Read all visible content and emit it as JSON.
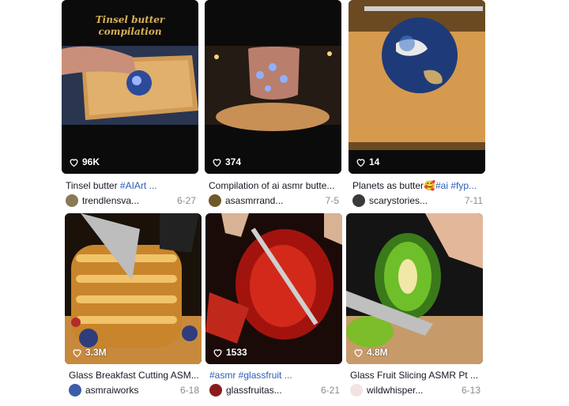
{
  "cards": [
    {
      "likes": "96K",
      "caption_text": "Tinsel butter ",
      "caption_tag": "#AIArt ...",
      "author": "trendlensva...",
      "date": "6-27",
      "overlay_title_1": "Tinsel butter",
      "overlay_title_2": "compilation",
      "avatar_color": "#8a7a55"
    },
    {
      "likes": "374",
      "caption_text": "Compilation of ai asmr butte...",
      "caption_tag": "",
      "author": "asasmrrand...",
      "date": "7-5",
      "avatar_color": "#6e5a2b"
    },
    {
      "likes": "14",
      "caption_text": "Planets as butter🥰",
      "caption_tag": "#ai #fyp...",
      "author": "scarystories...",
      "date": "7-11",
      "avatar_color": "#3a3a3a"
    },
    {
      "likes": "3.3M",
      "caption_text": "Glass Breakfast Cutting ASM...",
      "caption_tag": "",
      "author": "asmraiworks",
      "date": "6-18",
      "avatar_color": "#3b5ea8"
    },
    {
      "likes": "1533",
      "caption_text": "",
      "caption_tag": "#asmr #glassfruit ...",
      "author": "glassfruitas...",
      "date": "6-21",
      "avatar_color": "#8b1a1a"
    },
    {
      "likes": "4.8M",
      "caption_text": "Glass Fruit Slicing ASMR Pt ...",
      "caption_tag": "",
      "author": "wildwhisper...",
      "date": "6-13",
      "avatar_color": "#f3e3e3"
    }
  ]
}
